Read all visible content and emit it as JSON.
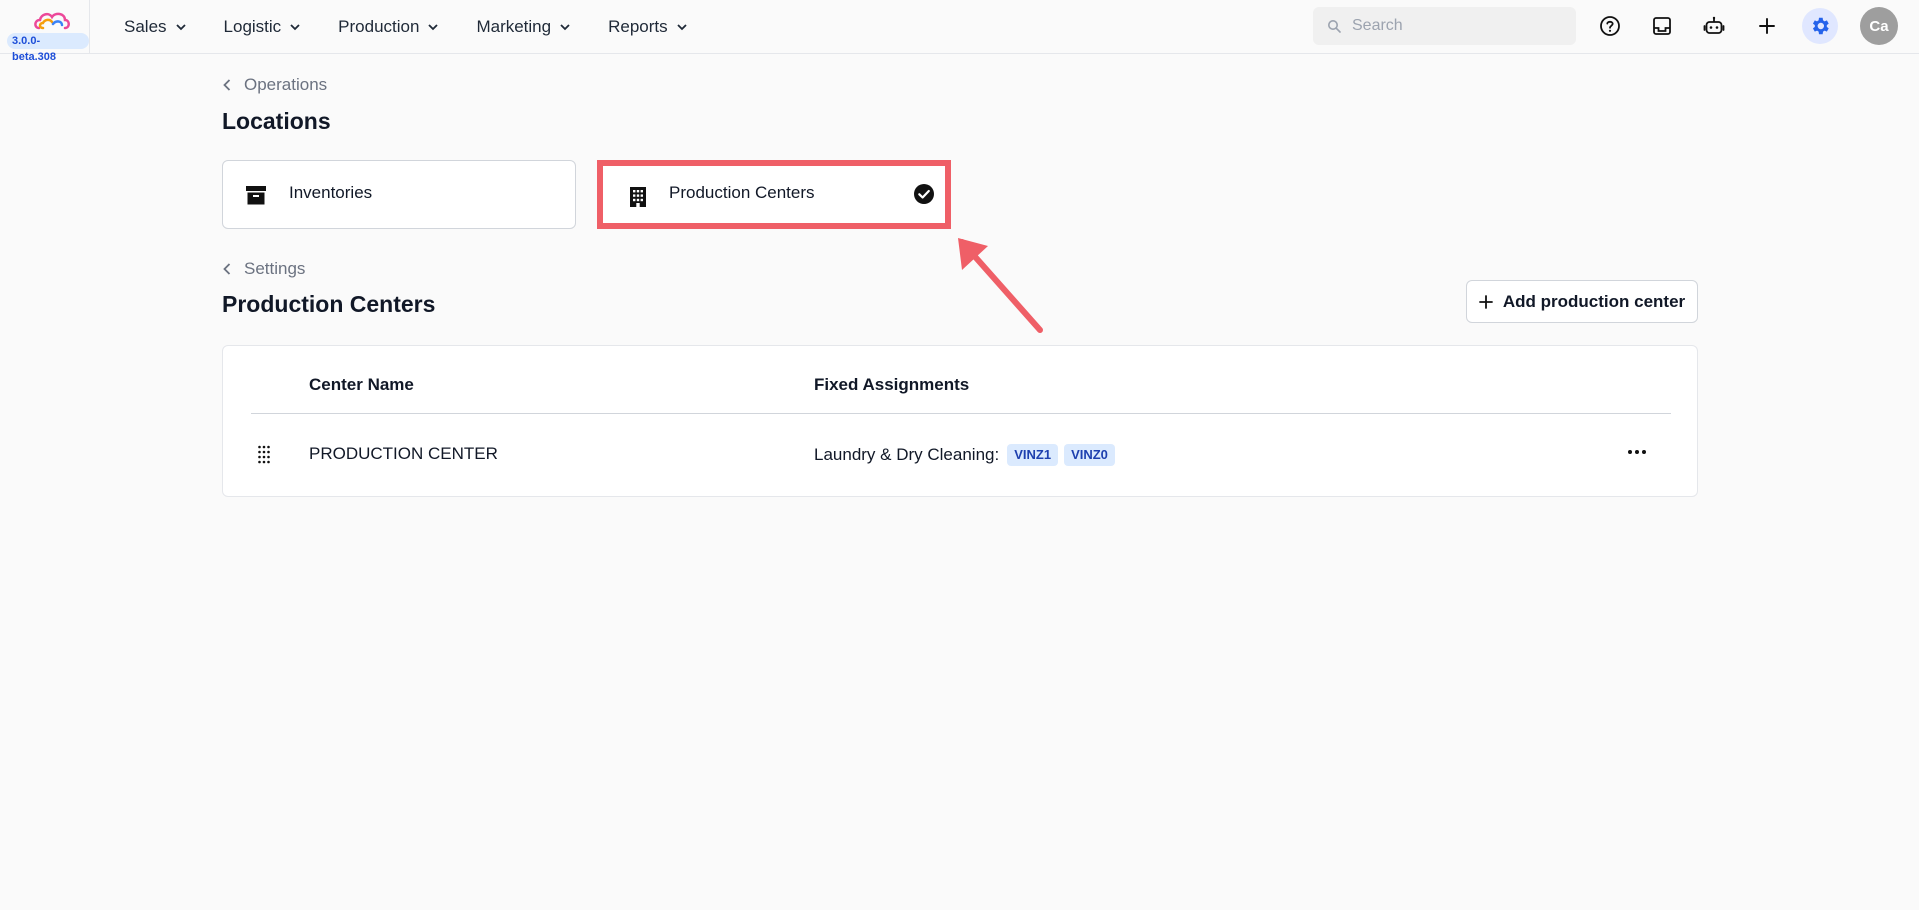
{
  "header": {
    "version": "3.0.0-beta.308",
    "nav": [
      {
        "label": "Sales"
      },
      {
        "label": "Logistic"
      },
      {
        "label": "Production"
      },
      {
        "label": "Marketing"
      },
      {
        "label": "Reports"
      }
    ],
    "search": {
      "placeholder": "Search",
      "value": ""
    },
    "avatar_initials": "Ca",
    "accent_color": "#2563eb"
  },
  "locations": {
    "breadcrumb": "Operations",
    "title": "Locations",
    "cards": [
      {
        "label": "Inventories",
        "icon": "archive-box-icon",
        "selected": false
      },
      {
        "label": "Production Centers",
        "icon": "building-icon",
        "selected": true
      }
    ]
  },
  "production_centers": {
    "breadcrumb": "Settings",
    "title": "Production Centers",
    "add_label": "Add production center",
    "columns": [
      "Center Name",
      "Fixed Assignments"
    ],
    "rows": [
      {
        "name": "PRODUCTION CENTER",
        "assignment_label": "Laundry & Dry Cleaning:",
        "badges": [
          "VINZ1",
          "VINZ0"
        ]
      }
    ]
  },
  "annotation": {
    "highlight_color": "#ef5f67"
  }
}
